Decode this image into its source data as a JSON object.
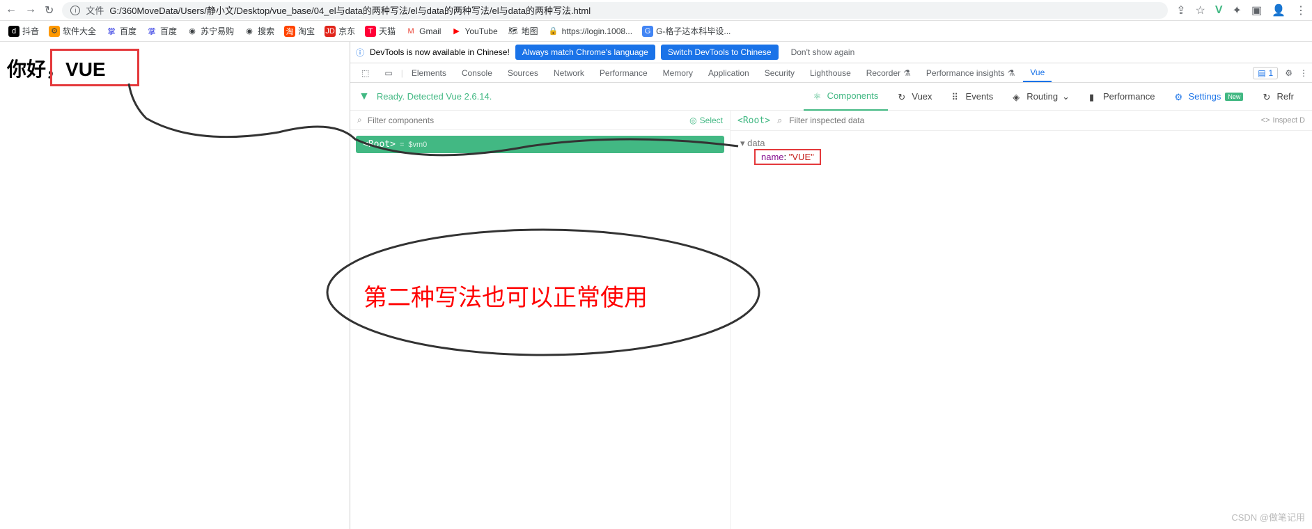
{
  "browser": {
    "file_label": "文件",
    "url": "G:/360MoveData/Users/静小文/Desktop/vue_base/04_el与data的两种写法/el与data的两种写法/el与data的两种写法.html"
  },
  "bookmarks": [
    {
      "label": "抖音"
    },
    {
      "label": "软件大全"
    },
    {
      "label": "百度"
    },
    {
      "label": "百度"
    },
    {
      "label": "苏宁易购"
    },
    {
      "label": "搜索"
    },
    {
      "label": "淘宝"
    },
    {
      "label": "京东"
    },
    {
      "label": "天猫"
    },
    {
      "label": "Gmail"
    },
    {
      "label": "YouTube"
    },
    {
      "label": "地图"
    },
    {
      "label": "https://login.1008..."
    },
    {
      "label": "G-格子达本科毕设..."
    }
  ],
  "page": {
    "hello_prefix": "你好，",
    "hello_name": "VUE"
  },
  "notice": {
    "text": "DevTools is now available in Chinese!",
    "btn1": "Always match Chrome's language",
    "btn2": "Switch DevTools to Chinese",
    "btn3": "Don't show again"
  },
  "devtools_tabs": {
    "elements": "Elements",
    "console": "Console",
    "sources": "Sources",
    "network": "Network",
    "performance": "Performance",
    "memory": "Memory",
    "application": "Application",
    "security": "Security",
    "lighthouse": "Lighthouse",
    "recorder": "Recorder",
    "perf_insights": "Performance insights",
    "vue": "Vue",
    "issues_count": "1"
  },
  "vue_toolbar": {
    "ready": "Ready. Detected Vue 2.6.14.",
    "components": "Components",
    "vuex": "Vuex",
    "events": "Events",
    "routing": "Routing",
    "performance": "Performance",
    "settings": "Settings",
    "new": "New",
    "refresh": "Refr"
  },
  "comp_panel": {
    "filter_placeholder": "Filter components",
    "select": "Select",
    "root": "<Root>",
    "eq": "=",
    "vm": "$vm0"
  },
  "inspector": {
    "root": "<Root>",
    "filter_placeholder": "Filter inspected data",
    "inspect_dom": "Inspect D",
    "data_section": "data",
    "prop_name": "name",
    "prop_value": "\"VUE\""
  },
  "annotation": "第二种写法也可以正常使用",
  "watermark": "CSDN @做笔记用"
}
